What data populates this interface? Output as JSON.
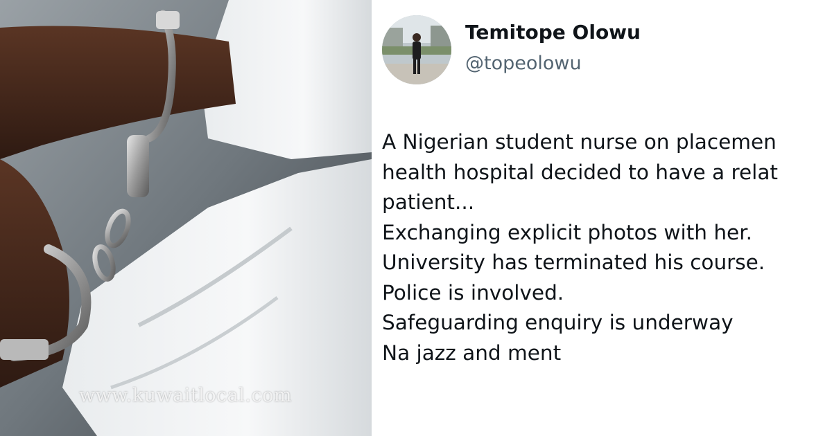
{
  "photo": {
    "watermark": "www.kuwaitlocal.com"
  },
  "tweet": {
    "author": {
      "name": "Temitope Olowu",
      "handle": "@topeolowu"
    },
    "lines": [
      "A Nigerian student nurse on placemen",
      "health hospital decided to have a relat",
      "patient...",
      "Exchanging explicit photos with her.",
      "University has terminated his course.",
      "Police is involved.",
      "Safeguarding enquiry is underway",
      "Na jazz and ment"
    ]
  }
}
